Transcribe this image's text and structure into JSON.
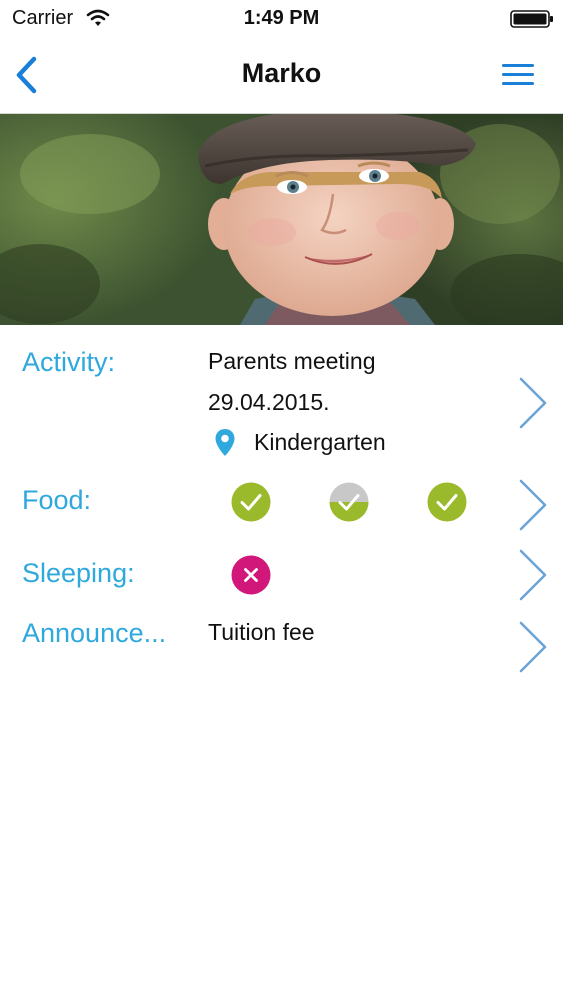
{
  "status_bar": {
    "carrier": "Carrier",
    "time": "1:49 PM"
  },
  "nav": {
    "title": "Marko",
    "back_icon": "chevron-left-icon",
    "menu_icon": "hamburger-menu-icon"
  },
  "colors": {
    "accent": "#2ea8dd",
    "nav_icon": "#1a7fd8",
    "check_green": "#9bba2b",
    "check_gray": "#c8c8c8",
    "cross_magenta": "#d1187a"
  },
  "rows": {
    "activity": {
      "label": "Activity:",
      "title": "Parents meeting",
      "date": "29.04.2015.",
      "location": "Kindergarten"
    },
    "food": {
      "label": "Food:",
      "meals": [
        "done",
        "pending",
        "done"
      ]
    },
    "sleeping": {
      "label": "Sleeping:",
      "status": "not-slept"
    },
    "announcements": {
      "label": "Announce...",
      "text": "Tuition fee"
    }
  }
}
